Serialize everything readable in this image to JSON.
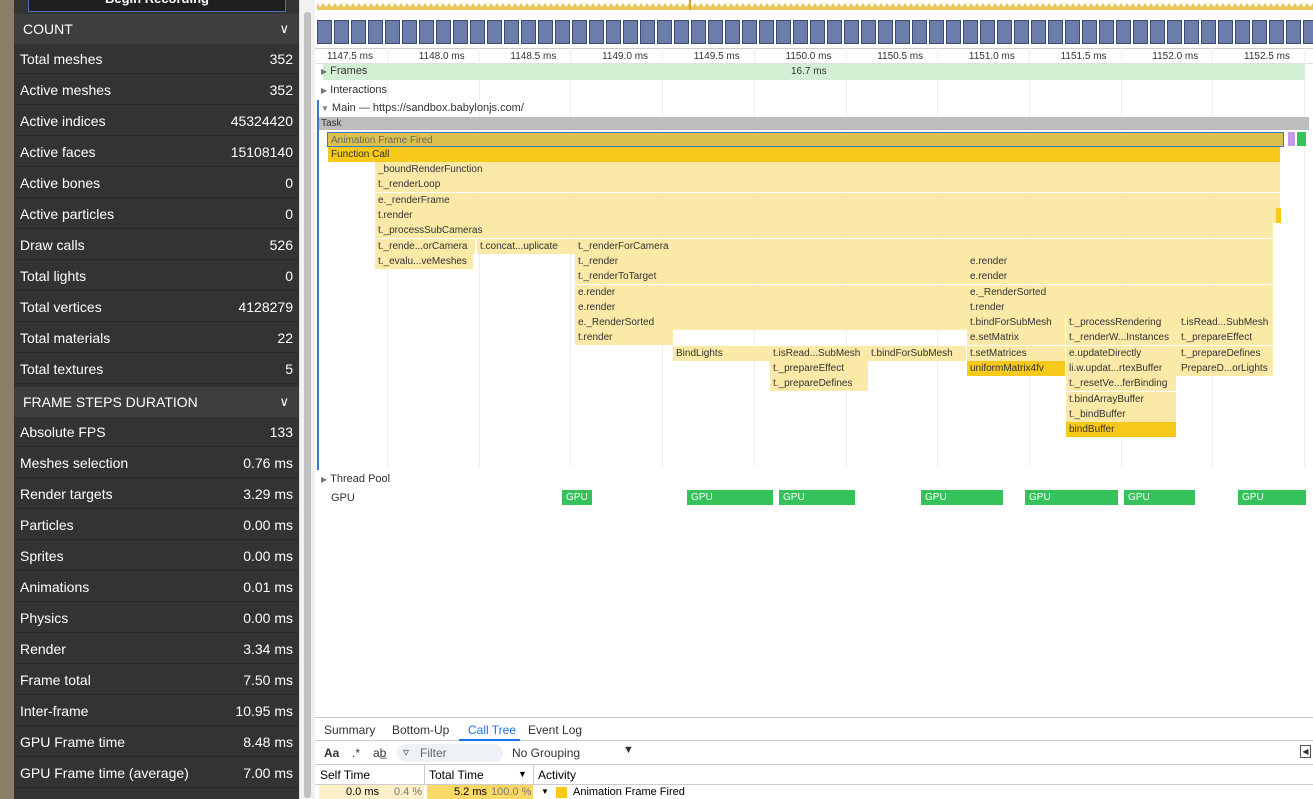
{
  "inspector": {
    "record_button": "Begin Recording",
    "count_section": {
      "title": "COUNT",
      "rows": [
        {
          "label": "Total meshes",
          "value": "352"
        },
        {
          "label": "Active meshes",
          "value": "352"
        },
        {
          "label": "Active indices",
          "value": "45324420"
        },
        {
          "label": "Active faces",
          "value": "15108140"
        },
        {
          "label": "Active bones",
          "value": "0"
        },
        {
          "label": "Active particles",
          "value": "0"
        },
        {
          "label": "Draw calls",
          "value": "526"
        },
        {
          "label": "Total lights",
          "value": "0"
        },
        {
          "label": "Total vertices",
          "value": "4128279"
        },
        {
          "label": "Total materials",
          "value": "22"
        },
        {
          "label": "Total textures",
          "value": "5"
        }
      ]
    },
    "frame_section": {
      "title": "FRAME STEPS DURATION",
      "rows": [
        {
          "label": "Absolute FPS",
          "value": "133"
        },
        {
          "label": "Meshes selection",
          "value": "0.76 ms"
        },
        {
          "label": "Render targets",
          "value": "3.29 ms"
        },
        {
          "label": "Particles",
          "value": "0.00 ms"
        },
        {
          "label": "Sprites",
          "value": "0.00 ms"
        },
        {
          "label": "Animations",
          "value": "0.01 ms"
        },
        {
          "label": "Physics",
          "value": "0.00 ms"
        },
        {
          "label": "Render",
          "value": "3.34 ms"
        },
        {
          "label": "Frame total",
          "value": "7.50 ms"
        },
        {
          "label": "Inter-frame",
          "value": "10.95 ms"
        },
        {
          "label": "GPU Frame time",
          "value": "8.48 ms"
        },
        {
          "label": "GPU Frame time (average)",
          "value": "7.00 ms"
        }
      ]
    }
  },
  "timeline": {
    "ruler_ticks": [
      "1147.5 ms",
      "1148.0 ms",
      "1148.5 ms",
      "1149.0 ms",
      "1149.5 ms",
      "1150.0 ms",
      "1150.5 ms",
      "1151.0 ms",
      "1151.5 ms",
      "1152.0 ms",
      "1152.5 ms"
    ],
    "tracks": {
      "frames": "Frames",
      "frame_duration": "16.7 ms",
      "interactions": "Interactions",
      "main": "Main — https://sandbox.babylonjs.com/",
      "thread_pool": "Thread Pool",
      "gpu": "GPU"
    },
    "task_label": "Task",
    "flame": [
      "Animation Frame Fired",
      "Function Call",
      "_boundRenderFunction",
      "t._renderLoop",
      "e._renderFrame",
      "t.render",
      "t._processSubCameras",
      "t._rende...orCamera",
      "t.concat...uplicate",
      "t._renderForCamera",
      "t._evalu...veMeshes",
      "t._render",
      "e.render",
      "t._renderToTarget",
      "e.render",
      "e.render",
      "e._RenderSorted",
      "e.render",
      "t.render",
      "e._RenderSorted",
      "t.bindForSubMesh",
      "t._processRendering",
      "t.isRead...SubMesh",
      "t.render",
      "e.setMatrix",
      "t._renderW...Instances",
      "t._prepareEffect",
      "BindLights",
      "t.isRead...SubMesh",
      "t.bindForSubMesh",
      "t.setMatrices",
      "e.updateDirectly",
      "t._prepareDefines",
      "t._prepareEffect",
      "uniformMatrix4fv",
      "li.w.updat...rtexBuffer",
      "PrepareD...orLights",
      "t._prepareDefines",
      "t._resetVe...ferBinding",
      "t.bindArrayBuffer",
      "t._bindBuffer",
      "bindBuffer"
    ],
    "gpu_blocks": [
      "GPU",
      "GPU",
      "GPU",
      "GPU",
      "GPU",
      "GPU",
      "GPU"
    ]
  },
  "bottom": {
    "tabs": [
      "Summary",
      "Bottom-Up",
      "Call Tree",
      "Event Log"
    ],
    "active_tab": "Call Tree",
    "match_case": "Aa",
    "regex": ".*",
    "whole_word": "ab̲",
    "filter_placeholder": "Filter",
    "grouping": "No Grouping",
    "columns": {
      "self": "Self Time",
      "total": "Total Time",
      "activity": "Activity"
    },
    "row": {
      "self_ms": "0.0 ms",
      "self_pct": "0.4 %",
      "total_ms": "5.2 ms",
      "total_pct": "100.0 %",
      "activity": "Animation Frame Fired"
    }
  },
  "colors": {
    "scripting": "#f6c91b",
    "gpu": "#36c25a",
    "selection": "#3c75c8",
    "inspector_bg": "#333333"
  }
}
